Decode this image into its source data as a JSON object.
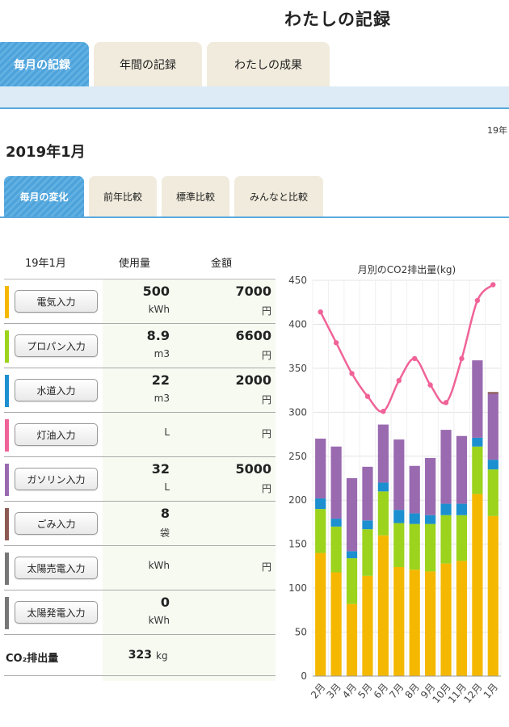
{
  "header": {
    "title": "わたしの記録"
  },
  "main_tabs": [
    {
      "label": "毎月の記録",
      "active": true
    },
    {
      "label": "年間の記録",
      "active": false
    },
    {
      "label": "わたしの成果",
      "active": false
    }
  ],
  "date_note": "19年",
  "month_title": "2019年1月",
  "sub_tabs": [
    {
      "label": "毎月の変化",
      "active": true
    },
    {
      "label": "前年比較",
      "active": false
    },
    {
      "label": "標準比較",
      "active": false
    },
    {
      "label": "みんなと比較",
      "active": false
    }
  ],
  "table": {
    "headers": {
      "month": "19年1月",
      "usage": "使用量",
      "amount": "金額"
    },
    "rows": [
      {
        "label": "電気入力",
        "color": "#f5b800",
        "usage": "500",
        "usage_unit": "kWh",
        "amount": "7000",
        "amount_unit": "円"
      },
      {
        "label": "プロパン入力",
        "color": "#9bd31d",
        "usage": "8.9",
        "usage_unit": "m3",
        "amount": "6600",
        "amount_unit": "円"
      },
      {
        "label": "水道入力",
        "color": "#1c8fd0",
        "usage": "22",
        "usage_unit": "m3",
        "amount": "2000",
        "amount_unit": "円"
      },
      {
        "label": "灯油入力",
        "color": "#f06398",
        "usage": "",
        "usage_unit": "L",
        "amount": "",
        "amount_unit": "円"
      },
      {
        "label": "ガソリン入力",
        "color": "#9a6ab0",
        "usage": "32",
        "usage_unit": "L",
        "amount": "5000",
        "amount_unit": "円"
      },
      {
        "label": "ごみ入力",
        "color": "#8d5a52",
        "usage": "8",
        "usage_unit": "袋",
        "amount": "",
        "amount_unit": ""
      },
      {
        "label": "太陽売電入力",
        "color": "#777777",
        "usage": "",
        "usage_unit": "kWh",
        "amount": "",
        "amount_unit": "円"
      },
      {
        "label": "太陽発電入力",
        "color": "#777777",
        "usage": "0",
        "usage_unit": "kWh",
        "amount": "",
        "amount_unit": ""
      }
    ],
    "co2": {
      "label": "CO₂排出量",
      "value": "323",
      "unit": "kg"
    }
  },
  "chart_data": {
    "type": "bar",
    "stacked": true,
    "title": "月別のCO2排出量(kg)",
    "categories": [
      "2月",
      "3月",
      "4月",
      "5月",
      "6月",
      "7月",
      "8月",
      "9月",
      "10月",
      "11月",
      "12月",
      "1月"
    ],
    "ylim": [
      0,
      450
    ],
    "yticks": [
      0,
      50,
      100,
      150,
      200,
      250,
      300,
      350,
      400,
      450
    ],
    "grid": true,
    "series": [
      {
        "key": "electricity",
        "color": "#f5b800",
        "values": [
          140,
          118,
          82,
          114,
          160,
          124,
          121,
          119,
          128,
          131,
          207,
          182
        ]
      },
      {
        "key": "propane",
        "color": "#9bd31d",
        "values": [
          50,
          52,
          52,
          53,
          50,
          50,
          52,
          54,
          55,
          52,
          54,
          53
        ]
      },
      {
        "key": "water",
        "color": "#1c8fd0",
        "values": [
          12,
          9,
          8,
          10,
          10,
          15,
          12,
          10,
          13,
          13,
          10,
          11
        ]
      },
      {
        "key": "gasoline",
        "color": "#9a6ab0",
        "values": [
          68,
          82,
          83,
          61,
          66,
          80,
          54,
          65,
          84,
          77,
          88,
          75
        ]
      },
      {
        "key": "garbage",
        "color": "#8d5a52",
        "values": [
          0,
          0,
          0,
          0,
          0,
          0,
          0,
          0,
          0,
          0,
          0,
          2
        ]
      }
    ],
    "line": {
      "color": "#f06398",
      "values": [
        414,
        379,
        344,
        318,
        301,
        336,
        361,
        331,
        311,
        361,
        427,
        445
      ]
    }
  }
}
